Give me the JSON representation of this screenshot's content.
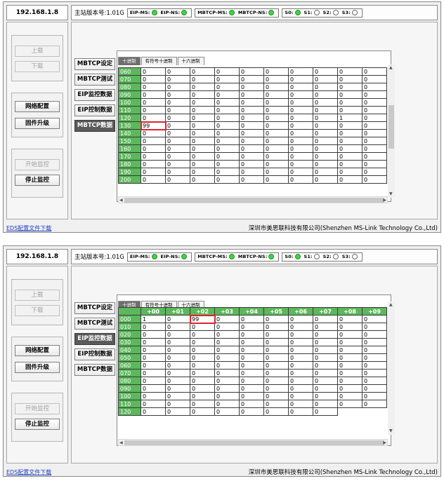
{
  "panels": [
    {
      "ip": "192.168.1.8",
      "version": "主站版本号:1.01G",
      "status": [
        [
          {
            "label": "EIP-MS:",
            "on": true
          },
          {
            "label": "EIP-NS:",
            "on": true
          }
        ],
        [
          {
            "label": "MBTCP-MS:",
            "on": true
          },
          {
            "label": "MBTCP-NS:",
            "on": true
          }
        ],
        [
          {
            "label": "S0:",
            "on": true
          },
          {
            "label": "S1:",
            "on": false
          },
          {
            "label": "S2:",
            "on": false
          },
          {
            "label": "S3:",
            "on": false
          }
        ]
      ],
      "buttons": {
        "upload": "上载",
        "download": "下载",
        "network": "网络配置",
        "firmware": "固件升级",
        "start": "开始监控",
        "stop": "停止监控"
      },
      "tabs": [
        "MBTCP设定",
        "MBTCP测试",
        "EIP监控数据",
        "EIP控制数据",
        "MBTCP数据"
      ],
      "active_tab": 4,
      "format_tabs": [
        "十进制",
        "有符号十进制",
        "十六进制"
      ],
      "active_format": 0,
      "columns": [],
      "rows": [
        {
          "label": "060",
          "values": [
            "0",
            "0",
            "0",
            "0",
            "0",
            "0",
            "0",
            "0",
            "0",
            "0"
          ]
        },
        {
          "label": "070",
          "values": [
            "0",
            "0",
            "0",
            "0",
            "0",
            "0",
            "0",
            "0",
            "0",
            "0"
          ]
        },
        {
          "label": "080",
          "values": [
            "0",
            "0",
            "0",
            "0",
            "0",
            "0",
            "0",
            "0",
            "0",
            "0"
          ]
        },
        {
          "label": "090",
          "values": [
            "0",
            "0",
            "0",
            "0",
            "0",
            "0",
            "0",
            "0",
            "0",
            "0"
          ]
        },
        {
          "label": "100",
          "values": [
            "0",
            "0",
            "0",
            "0",
            "0",
            "0",
            "0",
            "0",
            "0",
            "0"
          ]
        },
        {
          "label": "110",
          "values": [
            "0",
            "0",
            "0",
            "0",
            "0",
            "0",
            "0",
            "0",
            "0",
            "0"
          ]
        },
        {
          "label": "120",
          "values": [
            "0",
            "0",
            "0",
            "0",
            "0",
            "0",
            "0",
            "0",
            "1",
            "0"
          ]
        },
        {
          "label": "130",
          "values": [
            "99",
            "0",
            "0",
            "0",
            "0",
            "0",
            "0",
            "0",
            "0",
            "0"
          ]
        },
        {
          "label": "140",
          "values": [
            "0",
            "0",
            "0",
            "0",
            "0",
            "0",
            "0",
            "0",
            "0",
            "0"
          ]
        },
        {
          "label": "150",
          "values": [
            "0",
            "0",
            "0",
            "0",
            "0",
            "0",
            "0",
            "0",
            "0",
            "0"
          ]
        },
        {
          "label": "160",
          "values": [
            "0",
            "0",
            "0",
            "0",
            "0",
            "0",
            "0",
            "0",
            "0",
            "0"
          ]
        },
        {
          "label": "170",
          "values": [
            "0",
            "0",
            "0",
            "0",
            "0",
            "0",
            "0",
            "0",
            "0",
            "0"
          ]
        },
        {
          "label": "180",
          "values": [
            "0",
            "0",
            "0",
            "0",
            "0",
            "0",
            "0",
            "0",
            "0",
            "0"
          ]
        },
        {
          "label": "190",
          "values": [
            "0",
            "0",
            "0",
            "0",
            "0",
            "0",
            "0",
            "0",
            "0",
            "0"
          ]
        },
        {
          "label": "200",
          "values": [
            "0",
            "0",
            "0",
            "0",
            "0",
            "0",
            "0",
            "0",
            "0",
            "0"
          ]
        }
      ],
      "highlight": {
        "row": 7,
        "col": 0
      },
      "footer_link": "EDS配置文件下载",
      "company": "深圳市美思联科技有限公司(Shenzhen MS-Link Technology Co.,Ltd)"
    },
    {
      "ip": "192.168.1.8",
      "version": "主站版本号:1.01G",
      "status": [
        [
          {
            "label": "EIP-MS:",
            "on": true
          },
          {
            "label": "EIP-NS:",
            "on": true
          }
        ],
        [
          {
            "label": "MBTCP-MS:",
            "on": true
          },
          {
            "label": "MBTCP-NS:",
            "on": true
          }
        ],
        [
          {
            "label": "S0:",
            "on": true
          },
          {
            "label": "S1:",
            "on": false
          },
          {
            "label": "S2:",
            "on": false
          },
          {
            "label": "S3:",
            "on": false
          }
        ]
      ],
      "buttons": {
        "upload": "上载",
        "download": "下载",
        "network": "网络配置",
        "firmware": "固件升级",
        "start": "开始监控",
        "stop": "停止监控"
      },
      "tabs": [
        "MBTCP设定",
        "MBTCP测试",
        "EIP监控数据",
        "EIP控制数据",
        "MBTCP数据"
      ],
      "active_tab": 2,
      "format_tabs": [
        "十进制",
        "有符号十进制",
        "十六进制"
      ],
      "active_format": 0,
      "columns": [
        "+00",
        "+01",
        "+02",
        "+03",
        "+04",
        "+05",
        "+06",
        "+07",
        "+08",
        "+09"
      ],
      "rows": [
        {
          "label": "000",
          "values": [
            "1",
            "0",
            "99",
            "0",
            "0",
            "0",
            "0",
            "0",
            "0",
            "0"
          ]
        },
        {
          "label": "010",
          "values": [
            "0",
            "0",
            "0",
            "0",
            "0",
            "0",
            "0",
            "0",
            "0",
            "0"
          ]
        },
        {
          "label": "020",
          "values": [
            "0",
            "0",
            "0",
            "0",
            "0",
            "0",
            "0",
            "0",
            "0",
            "0"
          ]
        },
        {
          "label": "030",
          "values": [
            "0",
            "0",
            "0",
            "0",
            "0",
            "0",
            "0",
            "0",
            "0",
            "0"
          ]
        },
        {
          "label": "040",
          "values": [
            "0",
            "0",
            "0",
            "0",
            "0",
            "0",
            "0",
            "0",
            "0",
            "0"
          ]
        },
        {
          "label": "050",
          "values": [
            "0",
            "0",
            "0",
            "0",
            "0",
            "0",
            "0",
            "0",
            "0",
            "0"
          ]
        },
        {
          "label": "060",
          "values": [
            "0",
            "0",
            "0",
            "0",
            "0",
            "0",
            "0",
            "0",
            "0",
            "0"
          ]
        },
        {
          "label": "070",
          "values": [
            "0",
            "0",
            "0",
            "0",
            "0",
            "0",
            "0",
            "0",
            "0",
            "0"
          ]
        },
        {
          "label": "080",
          "values": [
            "0",
            "0",
            "0",
            "0",
            "0",
            "0",
            "0",
            "0",
            "0",
            "0"
          ]
        },
        {
          "label": "090",
          "values": [
            "0",
            "0",
            "0",
            "0",
            "0",
            "0",
            "0",
            "0",
            "0",
            "0"
          ]
        },
        {
          "label": "100",
          "values": [
            "0",
            "0",
            "0",
            "0",
            "0",
            "0",
            "0",
            "0",
            "0",
            "0"
          ]
        },
        {
          "label": "110",
          "values": [
            "0",
            "0",
            "0",
            "0",
            "0",
            "0",
            "0",
            "0",
            "0",
            "0"
          ]
        },
        {
          "label": "120",
          "values": [
            "0",
            "0",
            "0",
            "0",
            "0",
            "0",
            "0",
            "0"
          ]
        }
      ],
      "highlight": {
        "row": 0,
        "col": 2
      },
      "footer_link": "EDS配置文件下载",
      "company": "深圳市美思联科技有限公司(Shenzhen MS-Link Technology Co.,Ltd)"
    }
  ]
}
